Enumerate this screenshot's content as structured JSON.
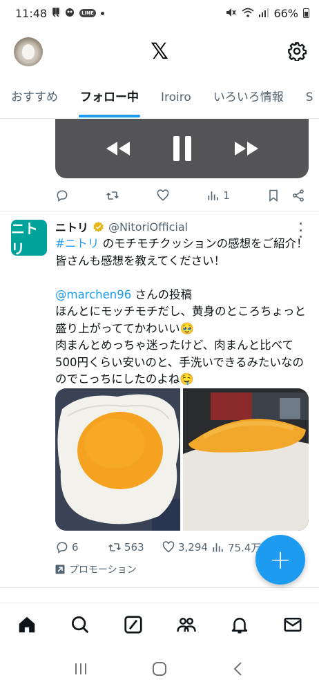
{
  "status_bar": {
    "time": "11:48",
    "line_label": "LINE",
    "battery": "66%"
  },
  "header": {
    "logo": "𝕏"
  },
  "tabs": [
    {
      "label": "おすすめ",
      "active": false
    },
    {
      "label": "フォロー中",
      "active": true
    },
    {
      "label": "Iroiro",
      "active": false
    },
    {
      "label": "いろいろ情報",
      "active": false
    },
    {
      "label": "S",
      "active": false
    }
  ],
  "prev_post": {
    "views": "1"
  },
  "tweet": {
    "avatar_text": "ニトリ",
    "name": "ニトリ",
    "handle": "@NitoriOfficial",
    "hashtag": "#ニトリ",
    "line1_rest": " のモチモチクッションの感想をご紹介！",
    "line2": "皆さんも感想を教えてください！",
    "mention": "@marchen96",
    "mention_rest": " さんの投稿",
    "body_lines": [
      "ほんとにモッチモチだし、黄身のところちょっと",
      "盛り上がっててかわいい🥹",
      "肉まんとめっちゃ迷ったけど、肉まんと比べて",
      "500円くらい安いのと、手洗いできるみたいなの",
      "のでこっちにしたのよね🤤"
    ],
    "replies": "6",
    "retweets": "563",
    "likes": "3,294",
    "views": "75.4万",
    "promo_label": "プロモーション"
  },
  "colors": {
    "accent": "#1d9bf0",
    "player_bg": "#545456",
    "nitori_green": "#00a39a",
    "verified_gold": "#e2b719"
  }
}
